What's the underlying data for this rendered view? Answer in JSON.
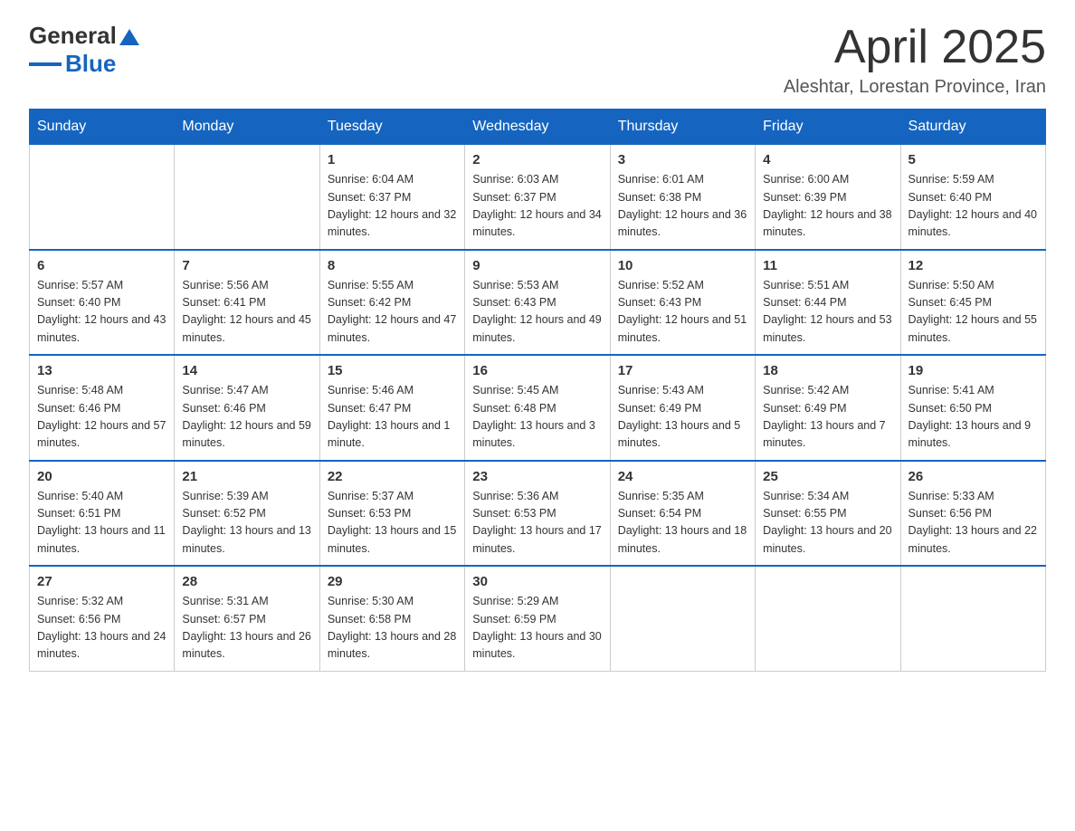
{
  "header": {
    "logo": {
      "general": "General",
      "blue": "Blue"
    },
    "title": "April 2025",
    "location": "Aleshtar, Lorestan Province, Iran"
  },
  "days_of_week": [
    "Sunday",
    "Monday",
    "Tuesday",
    "Wednesday",
    "Thursday",
    "Friday",
    "Saturday"
  ],
  "weeks": [
    [
      {
        "day": "",
        "sunrise": "",
        "sunset": "",
        "daylight": ""
      },
      {
        "day": "",
        "sunrise": "",
        "sunset": "",
        "daylight": ""
      },
      {
        "day": "1",
        "sunrise": "Sunrise: 6:04 AM",
        "sunset": "Sunset: 6:37 PM",
        "daylight": "Daylight: 12 hours and 32 minutes."
      },
      {
        "day": "2",
        "sunrise": "Sunrise: 6:03 AM",
        "sunset": "Sunset: 6:37 PM",
        "daylight": "Daylight: 12 hours and 34 minutes."
      },
      {
        "day": "3",
        "sunrise": "Sunrise: 6:01 AM",
        "sunset": "Sunset: 6:38 PM",
        "daylight": "Daylight: 12 hours and 36 minutes."
      },
      {
        "day": "4",
        "sunrise": "Sunrise: 6:00 AM",
        "sunset": "Sunset: 6:39 PM",
        "daylight": "Daylight: 12 hours and 38 minutes."
      },
      {
        "day": "5",
        "sunrise": "Sunrise: 5:59 AM",
        "sunset": "Sunset: 6:40 PM",
        "daylight": "Daylight: 12 hours and 40 minutes."
      }
    ],
    [
      {
        "day": "6",
        "sunrise": "Sunrise: 5:57 AM",
        "sunset": "Sunset: 6:40 PM",
        "daylight": "Daylight: 12 hours and 43 minutes."
      },
      {
        "day": "7",
        "sunrise": "Sunrise: 5:56 AM",
        "sunset": "Sunset: 6:41 PM",
        "daylight": "Daylight: 12 hours and 45 minutes."
      },
      {
        "day": "8",
        "sunrise": "Sunrise: 5:55 AM",
        "sunset": "Sunset: 6:42 PM",
        "daylight": "Daylight: 12 hours and 47 minutes."
      },
      {
        "day": "9",
        "sunrise": "Sunrise: 5:53 AM",
        "sunset": "Sunset: 6:43 PM",
        "daylight": "Daylight: 12 hours and 49 minutes."
      },
      {
        "day": "10",
        "sunrise": "Sunrise: 5:52 AM",
        "sunset": "Sunset: 6:43 PM",
        "daylight": "Daylight: 12 hours and 51 minutes."
      },
      {
        "day": "11",
        "sunrise": "Sunrise: 5:51 AM",
        "sunset": "Sunset: 6:44 PM",
        "daylight": "Daylight: 12 hours and 53 minutes."
      },
      {
        "day": "12",
        "sunrise": "Sunrise: 5:50 AM",
        "sunset": "Sunset: 6:45 PM",
        "daylight": "Daylight: 12 hours and 55 minutes."
      }
    ],
    [
      {
        "day": "13",
        "sunrise": "Sunrise: 5:48 AM",
        "sunset": "Sunset: 6:46 PM",
        "daylight": "Daylight: 12 hours and 57 minutes."
      },
      {
        "day": "14",
        "sunrise": "Sunrise: 5:47 AM",
        "sunset": "Sunset: 6:46 PM",
        "daylight": "Daylight: 12 hours and 59 minutes."
      },
      {
        "day": "15",
        "sunrise": "Sunrise: 5:46 AM",
        "sunset": "Sunset: 6:47 PM",
        "daylight": "Daylight: 13 hours and 1 minute."
      },
      {
        "day": "16",
        "sunrise": "Sunrise: 5:45 AM",
        "sunset": "Sunset: 6:48 PM",
        "daylight": "Daylight: 13 hours and 3 minutes."
      },
      {
        "day": "17",
        "sunrise": "Sunrise: 5:43 AM",
        "sunset": "Sunset: 6:49 PM",
        "daylight": "Daylight: 13 hours and 5 minutes."
      },
      {
        "day": "18",
        "sunrise": "Sunrise: 5:42 AM",
        "sunset": "Sunset: 6:49 PM",
        "daylight": "Daylight: 13 hours and 7 minutes."
      },
      {
        "day": "19",
        "sunrise": "Sunrise: 5:41 AM",
        "sunset": "Sunset: 6:50 PM",
        "daylight": "Daylight: 13 hours and 9 minutes."
      }
    ],
    [
      {
        "day": "20",
        "sunrise": "Sunrise: 5:40 AM",
        "sunset": "Sunset: 6:51 PM",
        "daylight": "Daylight: 13 hours and 11 minutes."
      },
      {
        "day": "21",
        "sunrise": "Sunrise: 5:39 AM",
        "sunset": "Sunset: 6:52 PM",
        "daylight": "Daylight: 13 hours and 13 minutes."
      },
      {
        "day": "22",
        "sunrise": "Sunrise: 5:37 AM",
        "sunset": "Sunset: 6:53 PM",
        "daylight": "Daylight: 13 hours and 15 minutes."
      },
      {
        "day": "23",
        "sunrise": "Sunrise: 5:36 AM",
        "sunset": "Sunset: 6:53 PM",
        "daylight": "Daylight: 13 hours and 17 minutes."
      },
      {
        "day": "24",
        "sunrise": "Sunrise: 5:35 AM",
        "sunset": "Sunset: 6:54 PM",
        "daylight": "Daylight: 13 hours and 18 minutes."
      },
      {
        "day": "25",
        "sunrise": "Sunrise: 5:34 AM",
        "sunset": "Sunset: 6:55 PM",
        "daylight": "Daylight: 13 hours and 20 minutes."
      },
      {
        "day": "26",
        "sunrise": "Sunrise: 5:33 AM",
        "sunset": "Sunset: 6:56 PM",
        "daylight": "Daylight: 13 hours and 22 minutes."
      }
    ],
    [
      {
        "day": "27",
        "sunrise": "Sunrise: 5:32 AM",
        "sunset": "Sunset: 6:56 PM",
        "daylight": "Daylight: 13 hours and 24 minutes."
      },
      {
        "day": "28",
        "sunrise": "Sunrise: 5:31 AM",
        "sunset": "Sunset: 6:57 PM",
        "daylight": "Daylight: 13 hours and 26 minutes."
      },
      {
        "day": "29",
        "sunrise": "Sunrise: 5:30 AM",
        "sunset": "Sunset: 6:58 PM",
        "daylight": "Daylight: 13 hours and 28 minutes."
      },
      {
        "day": "30",
        "sunrise": "Sunrise: 5:29 AM",
        "sunset": "Sunset: 6:59 PM",
        "daylight": "Daylight: 13 hours and 30 minutes."
      },
      {
        "day": "",
        "sunrise": "",
        "sunset": "",
        "daylight": ""
      },
      {
        "day": "",
        "sunrise": "",
        "sunset": "",
        "daylight": ""
      },
      {
        "day": "",
        "sunrise": "",
        "sunset": "",
        "daylight": ""
      }
    ]
  ]
}
